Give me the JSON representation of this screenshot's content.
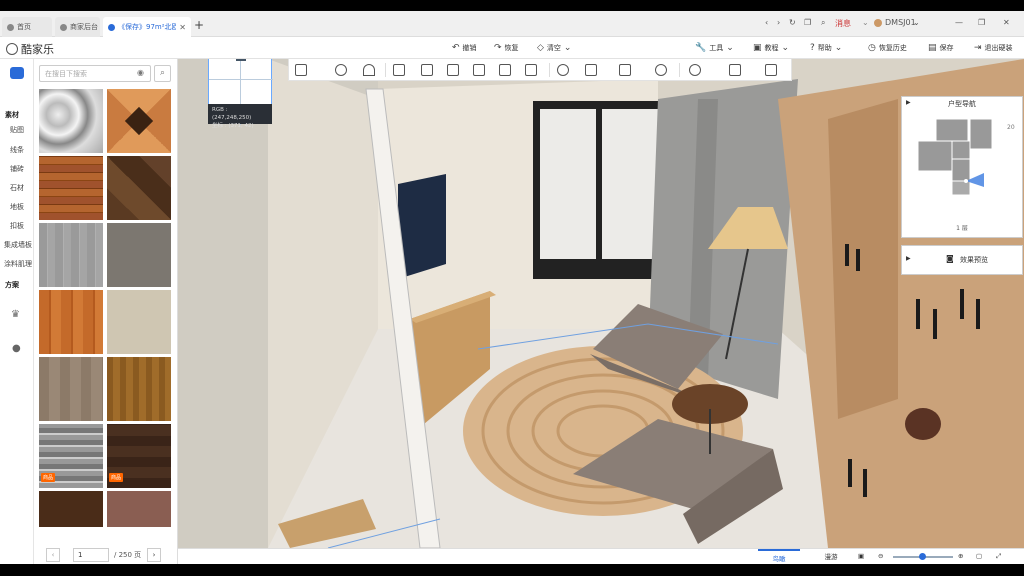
{
  "tabs": [
    {
      "label": "首页",
      "icon": "home-icon"
    },
    {
      "label": "商家后台",
      "icon": "store-icon"
    },
    {
      "label": "《保存》97m²北欧风2!",
      "icon": "doc-icon",
      "active": true
    }
  ],
  "titlebar": {
    "message_label": "消息",
    "user_name": "DMSJ01"
  },
  "toolbar": {
    "logo_text": "酷家乐",
    "undo_label": "撤销",
    "redo_label": "恢复",
    "clear_label": "清空",
    "tools_label": "工具",
    "tutorial_label": "教程",
    "help_label": "帮助",
    "history_label": "恢复历史",
    "save_label": "保存",
    "exit_label": "退出硬装"
  },
  "rail": {
    "categories": [
      {
        "label": "素材",
        "head": true
      },
      {
        "label": "贴图"
      },
      {
        "label": "线条"
      },
      {
        "label": "铺砖"
      },
      {
        "label": "石材"
      },
      {
        "label": "地板"
      },
      {
        "label": "扣板"
      },
      {
        "label": "集成墙板"
      },
      {
        "label": "涂料肌理"
      },
      {
        "label": "方案",
        "head": true
      }
    ]
  },
  "panel": {
    "search_placeholder": "在搜目下搜索",
    "hot_badge": "商品",
    "page_current": "1",
    "page_total": "/ 250 页"
  },
  "probe": {
    "rgb_text": "RGB : (247,248,250)",
    "coord_text": "坐标 : (371, 42)"
  },
  "nav": {
    "title": "户型导航",
    "zoom_text": "20",
    "floor_label": "1 层"
  },
  "render": {
    "label": "效果预览"
  },
  "bottom": {
    "view_tab": "鸟瞰",
    "walk_tab": "漫游"
  },
  "colors": {
    "accent": "#2a6bd8",
    "hot": "#ff6600"
  }
}
